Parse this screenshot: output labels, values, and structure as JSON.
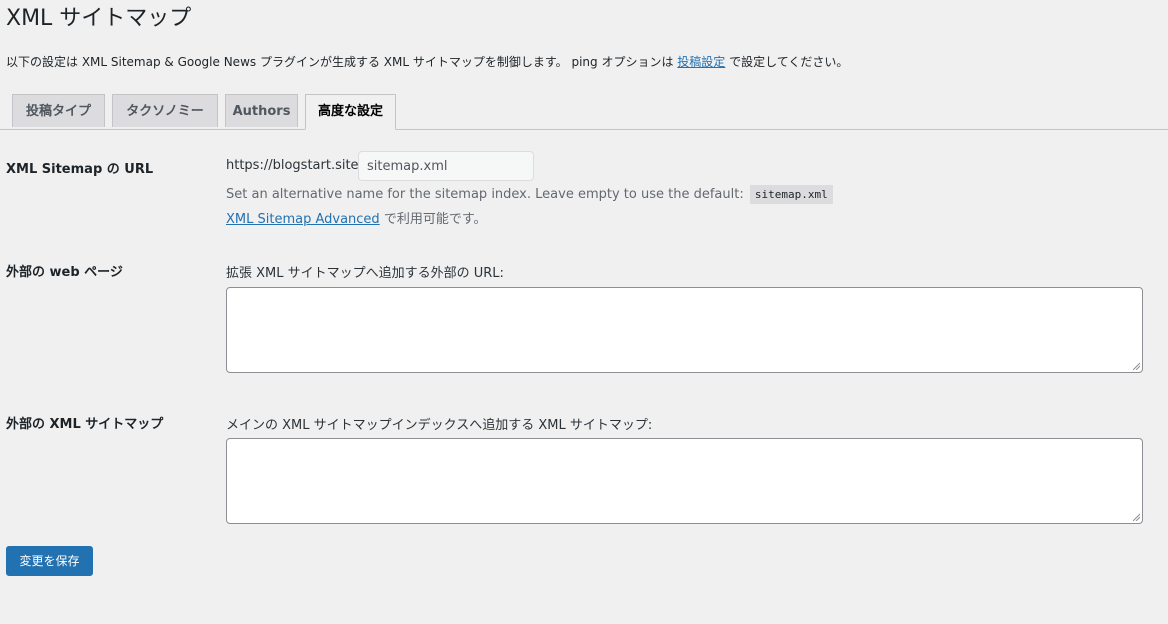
{
  "page": {
    "title": "XML サイトマップ",
    "description_before": "以下の設定は XML Sitemap & Google News プラグインが生成する XML サイトマップを制御します。 ping オプションは ",
    "description_link": "投稿設定",
    "description_after": " で設定してください。"
  },
  "tabs": [
    {
      "label": "投稿タイプ",
      "active": false
    },
    {
      "label": "タクソノミー",
      "active": false
    },
    {
      "label": "Authors",
      "active": false
    },
    {
      "label": "高度な設定",
      "active": true
    }
  ],
  "sitemap_url": {
    "label": "XML Sitemap の URL",
    "base_url": "https://blogstart.site/",
    "value": "sitemap.xml",
    "help_text": "Set an alternative name for the sitemap index. Leave empty to use the default:",
    "help_code": "sitemap.xml",
    "advanced_link": "XML Sitemap Advanced",
    "advanced_suffix": " で利用可能です。"
  },
  "external_pages": {
    "label": "外部の web ページ",
    "description": "拡張 XML サイトマップへ追加する外部の URL:",
    "value": ""
  },
  "external_sitemaps": {
    "label": "外部の XML サイトマップ",
    "description": "メインの XML サイトマップインデックスへ追加する XML サイトマップ:",
    "value": ""
  },
  "save_button": {
    "label": "変更を保存"
  },
  "colors": {
    "background": "#f0f0f1",
    "primary": "#2271b1",
    "link": "#2271b1",
    "tab_inactive": "#dcdcde"
  }
}
